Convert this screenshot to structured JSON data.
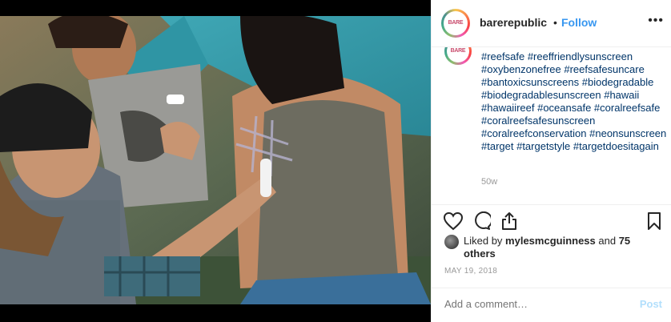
{
  "post": {
    "image_alt": "Friends at a campsite; a man draws with a sunscreen stick on a woman's shoulder"
  },
  "header": {
    "username": "barerepublic",
    "separator": "•",
    "follow_label": "Follow",
    "more_label": "•••",
    "avatar_logo": "BARE"
  },
  "caption": {
    "text": "#reefsafe #reeffriendlysunscreen #oxybenzonefree #reefsafesuncare #bantoxicsunscreens #biodegradable #biodegradablesunscreen #hawaii #hawaiireef #oceansafe #coralreefsafe #coralreefsafesunscreen #coralreefconservation #neonsunscreen #target #targetstyle #targetdoesitagain",
    "time_ago": "50w"
  },
  "actions": {
    "icons": [
      "heart-icon",
      "comment-icon",
      "share-icon",
      "bookmark-icon"
    ]
  },
  "likes": {
    "prefix": "Liked by ",
    "user": "mylesmcguinness",
    "middle": " and ",
    "others": "75 others"
  },
  "date": "MAY 19, 2018",
  "comment": {
    "placeholder": "Add a comment…",
    "post_label": "Post"
  },
  "colors": {
    "link_blue": "#3897f0",
    "hashtag": "#003569",
    "post_disabled": "#b2dffc",
    "muted": "#999999"
  }
}
